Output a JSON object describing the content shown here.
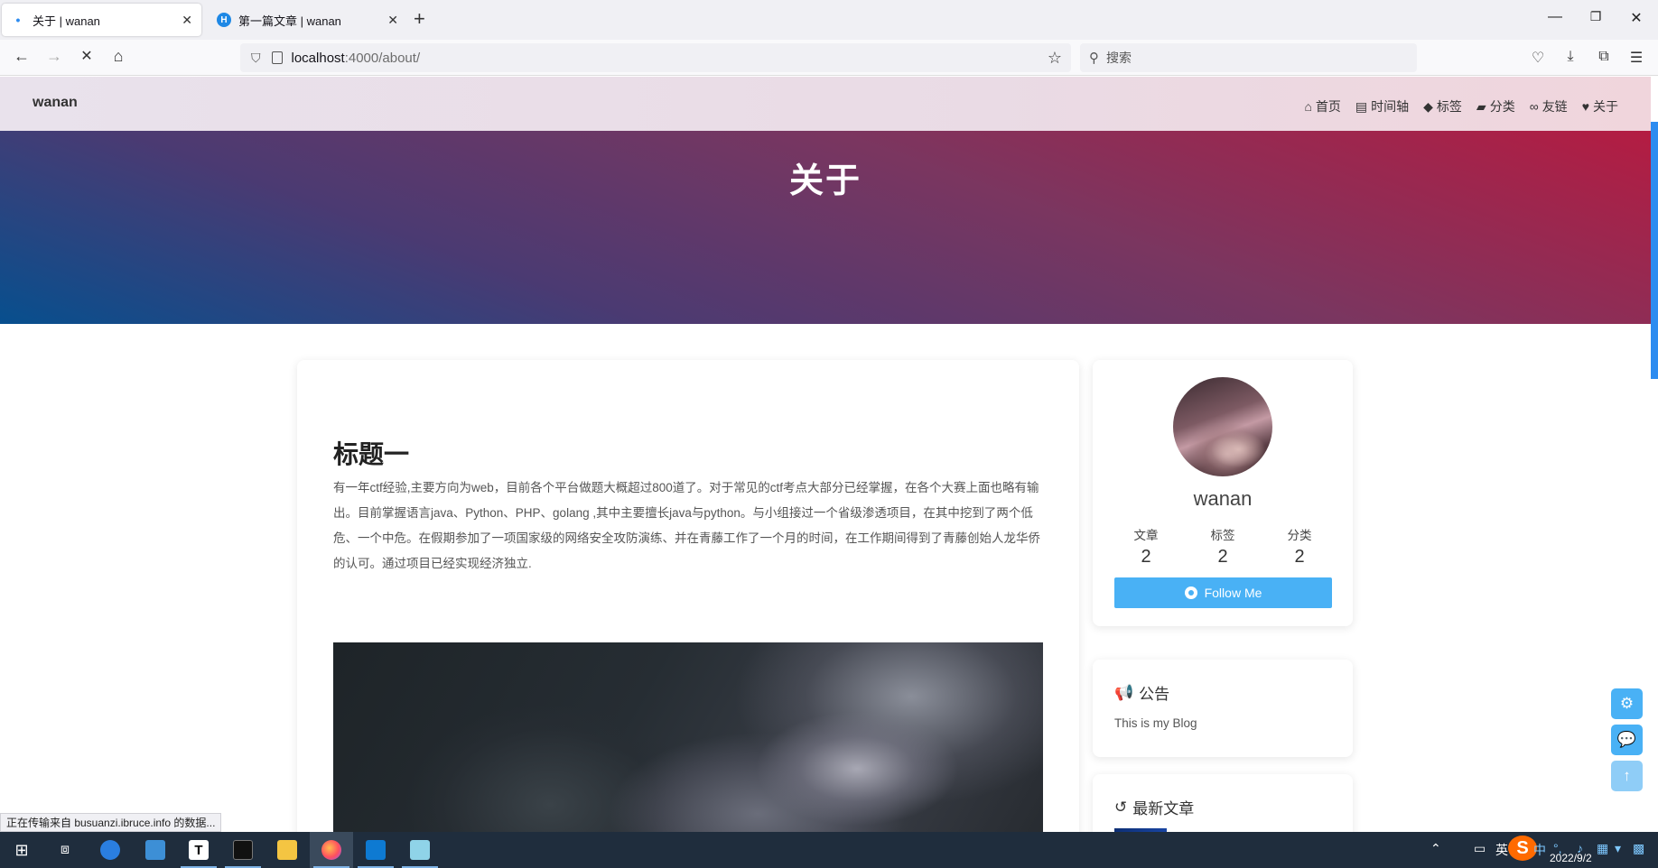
{
  "browser": {
    "tabs": [
      {
        "title": "关于 | wanan",
        "active": true
      },
      {
        "title": "第一篇文章 | wanan",
        "active": false
      }
    ],
    "new_tab": "+",
    "url_host": "localhost",
    "url_path": ":4000/about/",
    "search_placeholder": "搜索",
    "status_text": "正在传输来自 busuanzi.ibruce.info 的数据..."
  },
  "site": {
    "title": "wanan",
    "menu": [
      {
        "icon": "home-icon",
        "label": "首页"
      },
      {
        "icon": "archive-icon",
        "label": "时间轴"
      },
      {
        "icon": "tags-icon",
        "label": "标签"
      },
      {
        "icon": "folder-icon",
        "label": "分类"
      },
      {
        "icon": "link-icon",
        "label": "友链"
      },
      {
        "icon": "heart-icon",
        "label": "关于"
      }
    ],
    "banner_title": "关于"
  },
  "article": {
    "heading": "标题一",
    "paragraph": "有一年ctf经验,主要方向为web，目前各个平台做题大概超过800道了。对于常见的ctf考点大部分已经掌握，在各个大赛上面也略有输出。目前掌握语言java、Python、PHP、golang ,其中主要擅长java与python。与小组接过一个省级渗透项目，在其中挖到了两个低危、一个中危。在假期参加了一项国家级的网络安全攻防演练、并在青藤工作了一个月的时间，在工作期间得到了青藤创始人龙华侨的认可。通过项目已经实现经济独立."
  },
  "sidebar": {
    "author": "wanan",
    "stats": [
      {
        "label": "文章",
        "value": "2"
      },
      {
        "label": "标签",
        "value": "2"
      },
      {
        "label": "分类",
        "value": "2"
      }
    ],
    "follow_label": "Follow Me",
    "notice_title": "公告",
    "notice_text": "This is my Blog",
    "recent_title": "最新文章"
  },
  "taskbar": {
    "clock": "2022/9/2",
    "ime_lang": "英",
    "ime_cn": "中"
  },
  "colors": {
    "accent": "#49b1f5",
    "banner_top_right": "#b41c42",
    "banner_bottom_left": "#074f8e"
  }
}
